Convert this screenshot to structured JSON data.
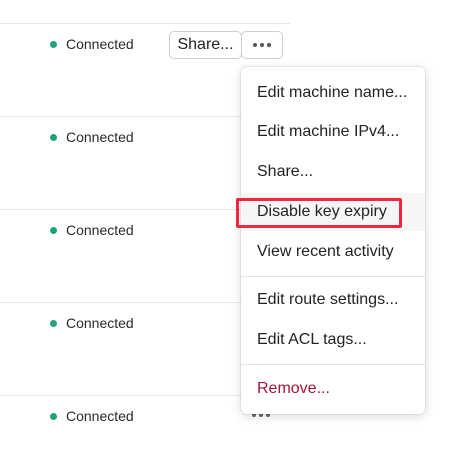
{
  "rows": [
    {
      "status": "Connected"
    },
    {
      "status": "Connected"
    },
    {
      "status": "Connected"
    },
    {
      "status": "Connected"
    },
    {
      "status": "Connected"
    }
  ],
  "row_actions": {
    "share_label": "Share...",
    "more_icon": "more-horizontal-icon"
  },
  "status_color": "#1fa37a",
  "menu": {
    "items": [
      {
        "label": "Edit machine name..."
      },
      {
        "label": "Edit machine IPv4..."
      },
      {
        "label": "Share..."
      },
      {
        "label": "Disable key expiry"
      },
      {
        "label": "View recent activity"
      },
      {
        "label": "Edit route settings..."
      },
      {
        "label": "Edit ACL tags..."
      },
      {
        "label": "Remove..."
      }
    ],
    "danger_color": "#a0183a",
    "highlight_color": "#f0273f"
  }
}
